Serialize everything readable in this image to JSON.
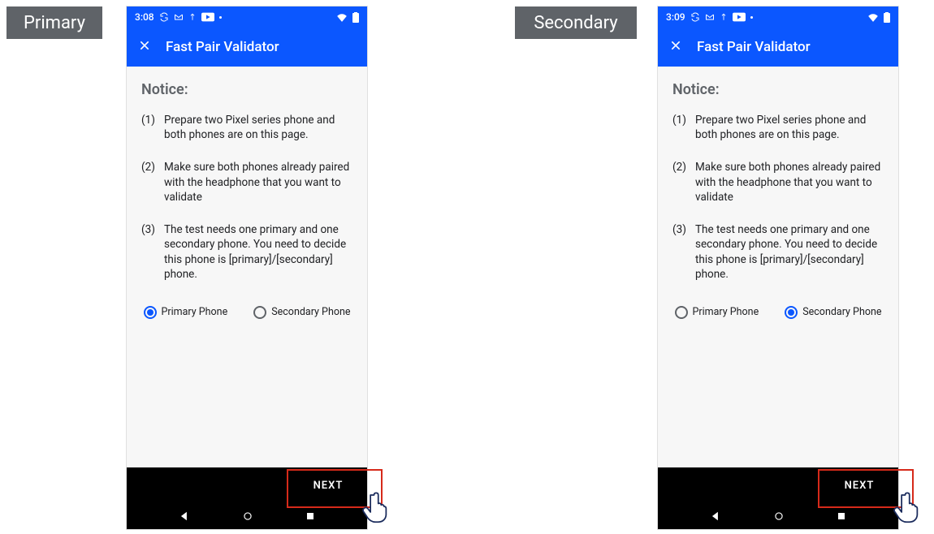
{
  "labels": {
    "primary_tag": "Primary",
    "secondary_tag": "Secondary"
  },
  "phones": [
    {
      "key": "primary",
      "statusbar": {
        "time": "3:08"
      },
      "header": {
        "title": "Fast Pair Validator"
      },
      "notice_heading": "Notice:",
      "notice": [
        "Prepare two Pixel series phone and both phones are on this page.",
        "Make sure both phones already paired with the headphone that you want to validate",
        "The test needs one primary and one secondary phone. You need to decide this phone is [primary]/[secondary] phone."
      ],
      "radios": {
        "primary_label": "Primary Phone",
        "secondary_label": "Secondary Phone",
        "selected": "primary"
      },
      "next_label": "NEXT"
    },
    {
      "key": "secondary",
      "statusbar": {
        "time": "3:09"
      },
      "header": {
        "title": "Fast Pair Validator"
      },
      "notice_heading": "Notice:",
      "notice": [
        "Prepare two Pixel series phone and both phones are on this page.",
        "Make sure both phones already paired with the headphone that you want to validate",
        "The test needs one primary and one secondary phone. You need to decide this phone is [primary]/[secondary] phone."
      ],
      "radios": {
        "primary_label": "Primary Phone",
        "secondary_label": "Secondary Phone",
        "selected": "secondary"
      },
      "next_label": "NEXT"
    }
  ],
  "colors": {
    "accent": "#0b57ff",
    "tag_bg": "#5f6368",
    "highlight": "#d62a1a"
  }
}
